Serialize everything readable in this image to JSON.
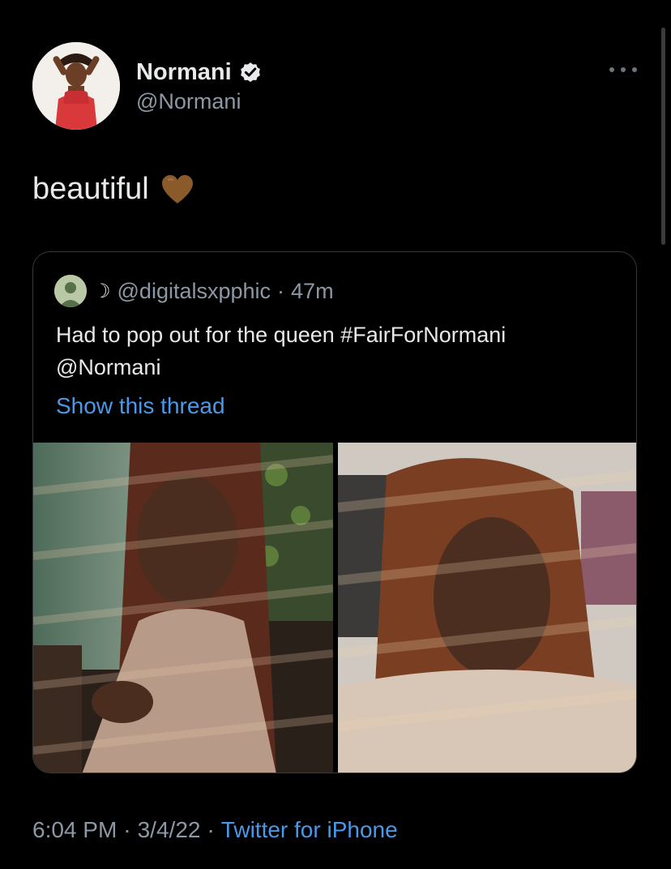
{
  "author": {
    "name": "Normani",
    "handle": "@Normani"
  },
  "tweet": {
    "text": "beautiful",
    "emoji": "brown-heart"
  },
  "quoted_tweet": {
    "moon_glyph": "☽",
    "handle": "@digitalsxpphic",
    "separator": "·",
    "time": "47m",
    "text_line1": "Had to pop out for the queen #FairForNormani",
    "text_line2": "@Normani",
    "show_thread": "Show this thread"
  },
  "meta": {
    "time": "6:04 PM",
    "separator1": "·",
    "date": "3/4/22",
    "separator2": "·",
    "source": "Twitter for iPhone"
  },
  "colors": {
    "background": "#000000",
    "text_primary": "#e7e9ea",
    "text_secondary": "#8b98a5",
    "link": "#4a99e9",
    "border": "#36393d",
    "heart": "#8b5a2b"
  }
}
